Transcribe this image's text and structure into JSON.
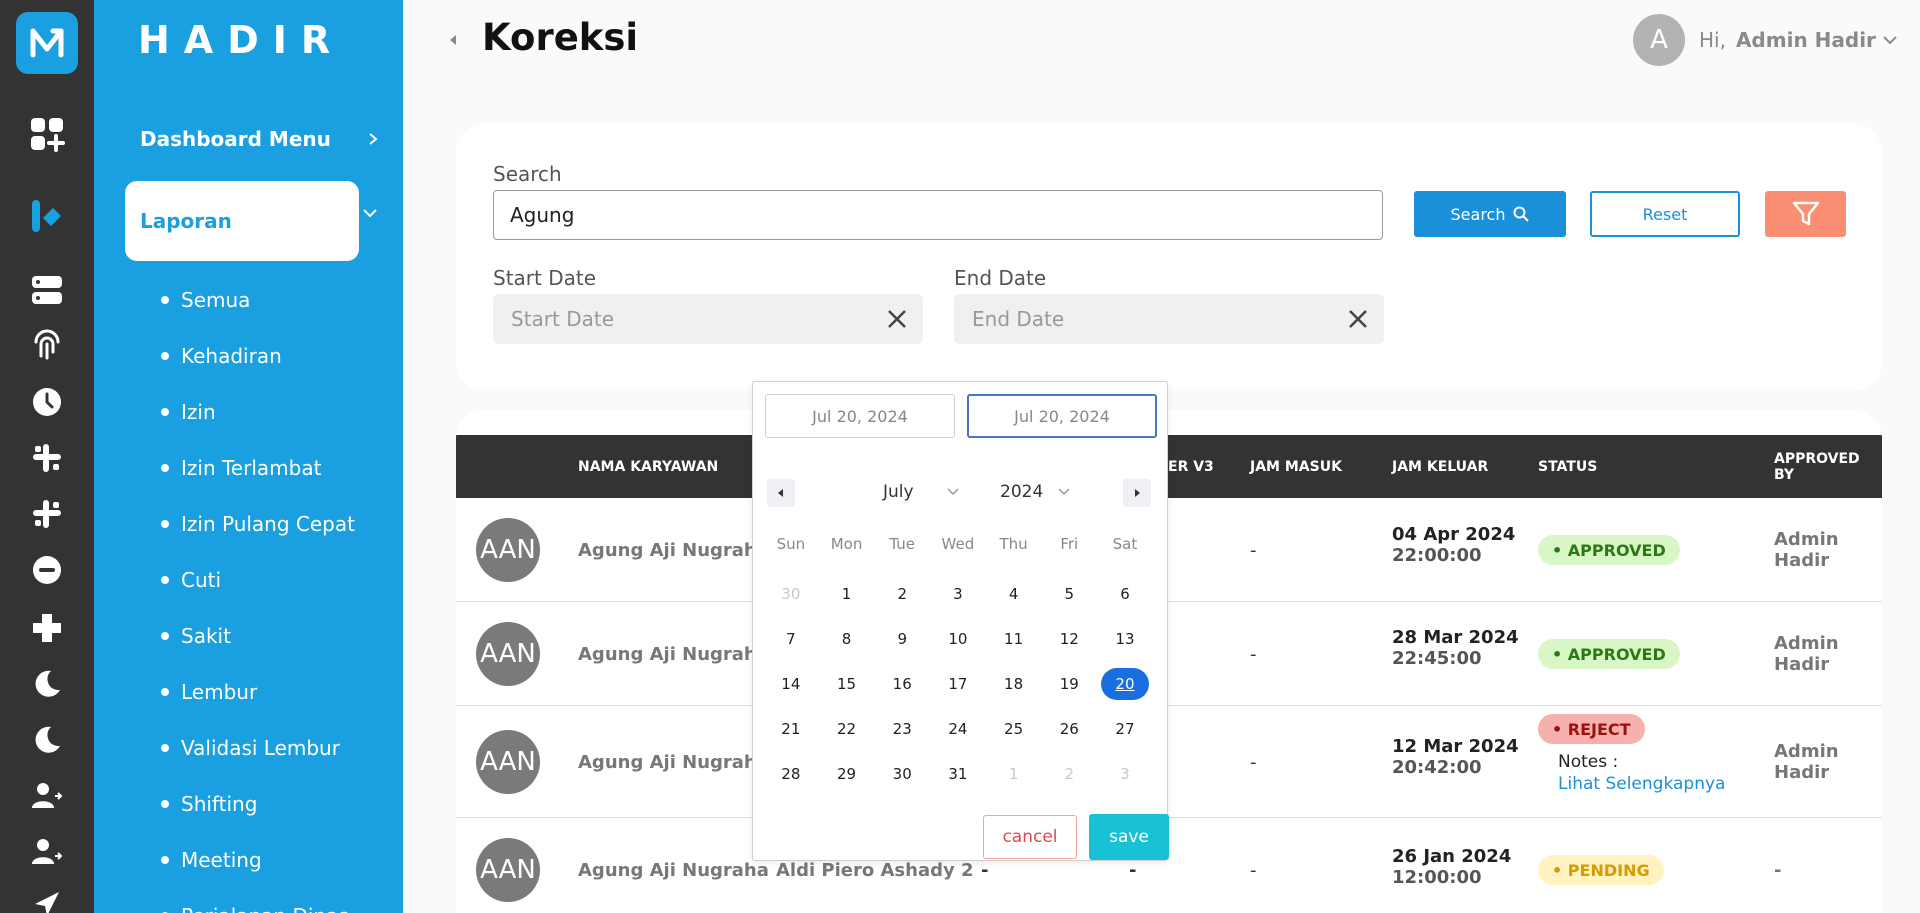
{
  "brand": {
    "name": "HADIR"
  },
  "header": {
    "title": "Koreksi",
    "avatar_letter": "A",
    "greeting": "Hi,",
    "user_name": "Admin Hadir"
  },
  "sidebar": {
    "dashboard_label": "Dashboard Menu",
    "active_section": "Laporan",
    "items": [
      {
        "label": "Semua"
      },
      {
        "label": "Kehadiran"
      },
      {
        "label": "Izin"
      },
      {
        "label": "Izin Terlambat"
      },
      {
        "label": "Izin Pulang Cepat"
      },
      {
        "label": "Cuti"
      },
      {
        "label": "Sakit"
      },
      {
        "label": "Lembur"
      },
      {
        "label": "Validasi Lembur"
      },
      {
        "label": "Shifting"
      },
      {
        "label": "Meeting"
      },
      {
        "label": "Perjalanan Dinas"
      }
    ]
  },
  "filter": {
    "search_label": "Search",
    "search_value": "Agung",
    "search_button": "Search",
    "reset_button": "Reset",
    "start_label": "Start Date",
    "start_placeholder": "Start Date",
    "end_label": "End Date",
    "end_placeholder": "End Date"
  },
  "table": {
    "headers": {
      "nama": "NAMA KARYAWAN",
      "v3_partial": "ER V3",
      "jam_masuk": "JAM MASUK",
      "jam_keluar": "JAM KELUAR",
      "status": "STATUS",
      "approved_by": "APPROVED BY"
    },
    "rows": [
      {
        "initials": "AAN",
        "name": "Agung Aji Nugraha",
        "jam_masuk": "-",
        "keluar_date": "04 Apr 2024",
        "keluar_time": "22:00:00",
        "status": "APPROVED",
        "approver": "Admin Hadir"
      },
      {
        "initials": "AAN",
        "name": "Agung Aji Nugraha",
        "jam_masuk": "-",
        "keluar_date": "28 Mar 2024",
        "keluar_time": "22:45:00",
        "status": "APPROVED",
        "approver": "Admin Hadir"
      },
      {
        "initials": "AAN",
        "name": "Agung Aji Nugraha",
        "jam_masuk": "-",
        "keluar_date": "12 Mar 2024",
        "keluar_time": "20:42:00",
        "status": "REJECT",
        "notes_label": "Notes :",
        "notes_link": "Lihat Selengkapnya",
        "approver": "Admin Hadir"
      },
      {
        "initials": "AAN",
        "name": "Agung Aji Nugraha",
        "second_name": "Aldi Piero Ashady 2",
        "col3": "-",
        "col4": "-",
        "jam_masuk": "-",
        "keluar_date": "26 Jan 2024",
        "keluar_time": "12:00:00",
        "status": "PENDING",
        "approver": "-"
      }
    ]
  },
  "datepicker": {
    "start_value": "Jul 20, 2024",
    "end_value": "Jul 20, 2024",
    "month": "July",
    "year": "2024",
    "weekdays": [
      "Sun",
      "Mon",
      "Tue",
      "Wed",
      "Thu",
      "Fri",
      "Sat"
    ],
    "weeks": [
      [
        "30",
        "1",
        "2",
        "3",
        "4",
        "5",
        "6"
      ],
      [
        "7",
        "8",
        "9",
        "10",
        "11",
        "12",
        "13"
      ],
      [
        "14",
        "15",
        "16",
        "17",
        "18",
        "19",
        "20"
      ],
      [
        "21",
        "22",
        "23",
        "24",
        "25",
        "26",
        "27"
      ],
      [
        "28",
        "29",
        "30",
        "31",
        "1",
        "2",
        "3"
      ]
    ],
    "selected_day": "20",
    "cancel_label": "cancel",
    "save_label": "save"
  },
  "colors": {
    "primary": "#1a9fe0",
    "rail": "#333333",
    "filter_button": "#f98e73",
    "save": "#18c1d6"
  }
}
